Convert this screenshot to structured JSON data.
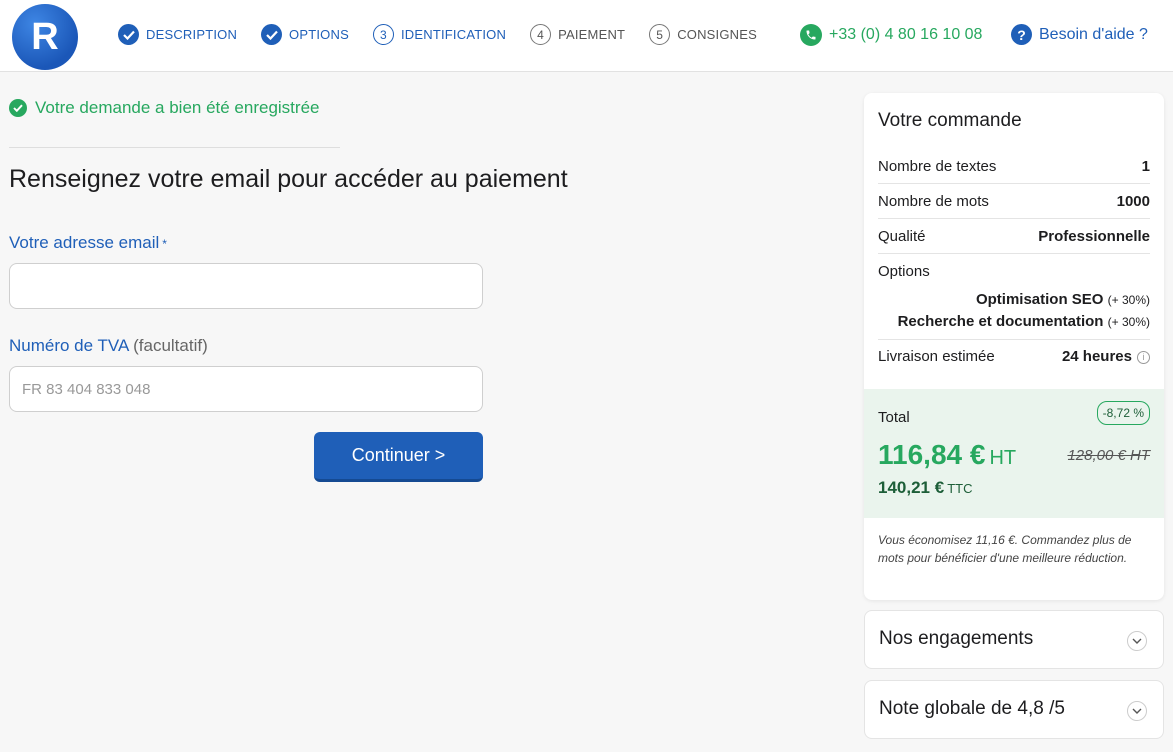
{
  "header": {
    "logo_letter": "R",
    "steps": [
      {
        "num": "",
        "label": "DESCRIPTION",
        "state": "done"
      },
      {
        "num": "",
        "label": "OPTIONS",
        "state": "done"
      },
      {
        "num": "3",
        "label": "IDENTIFICATION",
        "state": "current"
      },
      {
        "num": "4",
        "label": "PAIEMENT",
        "state": "todo"
      },
      {
        "num": "5",
        "label": "CONSIGNES",
        "state": "todo"
      }
    ],
    "phone": "+33 (0) 4 80 16 10 08",
    "help": "Besoin d'aide ?"
  },
  "main": {
    "success": "Votre demande a bien été enregistrée",
    "title": "Renseignez votre email pour accéder au paiement",
    "email_label": "Votre adresse email",
    "email_required": "*",
    "email_value": "",
    "vat_label": "Numéro de TVA",
    "vat_optional": "(facultatif)",
    "vat_placeholder": "FR 83 404 833 048",
    "continue_label": "Continuer >"
  },
  "order": {
    "title": "Votre commande",
    "rows": [
      {
        "label": "Nombre de textes",
        "value": "1"
      },
      {
        "label": "Nombre de mots",
        "value": "1000"
      },
      {
        "label": "Qualité",
        "value": "Professionnelle"
      }
    ],
    "options_label": "Options",
    "options": [
      {
        "name": "Optimisation SEO",
        "pct": "(+ 30%)"
      },
      {
        "name": "Recherche et documentation",
        "pct": "(+ 30%)"
      }
    ],
    "delivery_label": "Livraison estimée",
    "delivery_value": "24 heures",
    "total_label": "Total",
    "discount": "-8,72 %",
    "price_ht": "116,84 €",
    "ht_unit": "HT",
    "old_price": "128,00 € HT",
    "price_ttc": "140,21 €",
    "ttc_unit": "TTC",
    "savings_note": "Vous économisez 11,16 €. Commandez plus de mots pour bénéficier d'une meilleure réduction."
  },
  "accordions": [
    "Nos engagements",
    "Note globale de 4,8 /5"
  ],
  "colors": {
    "primary": "#1f5fb8",
    "success": "#27a85f",
    "total_bg": "#eaf4ed"
  }
}
